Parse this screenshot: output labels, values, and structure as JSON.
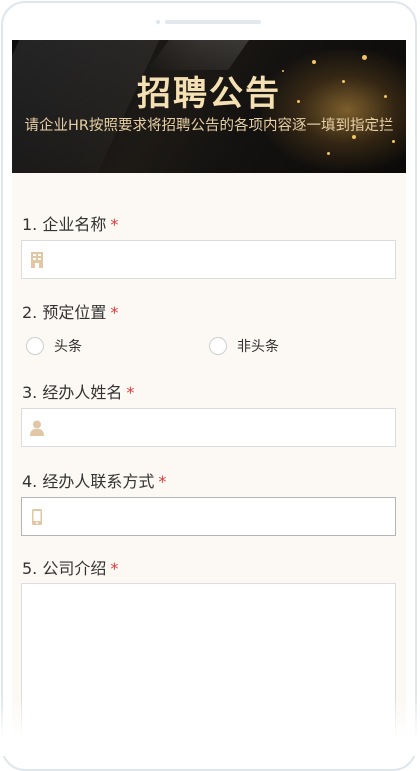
{
  "banner": {
    "title": "招聘公告",
    "subtitle": "请企业HR按照要求将招聘公告的各项内容逐一填到指定拦"
  },
  "questions": [
    {
      "label": "1. 企业名称",
      "required": "*",
      "icon": "building-icon",
      "value": ""
    },
    {
      "label": "2. 预定位置",
      "required": "*",
      "options": [
        "头条",
        "非头条"
      ]
    },
    {
      "label": "3. 经办人姓名",
      "required": "*",
      "icon": "person-icon",
      "value": ""
    },
    {
      "label": "4. 经办人联系方式",
      "required": "*",
      "icon": "phone-icon",
      "value": ""
    },
    {
      "label": "5. 公司介绍",
      "required": "*",
      "value": ""
    }
  ],
  "colors": {
    "accent_gold": "#f5e0b4",
    "icon_tan": "#e1c7a5",
    "required_red": "#e03a3a",
    "form_bg": "#fcf8f4"
  }
}
